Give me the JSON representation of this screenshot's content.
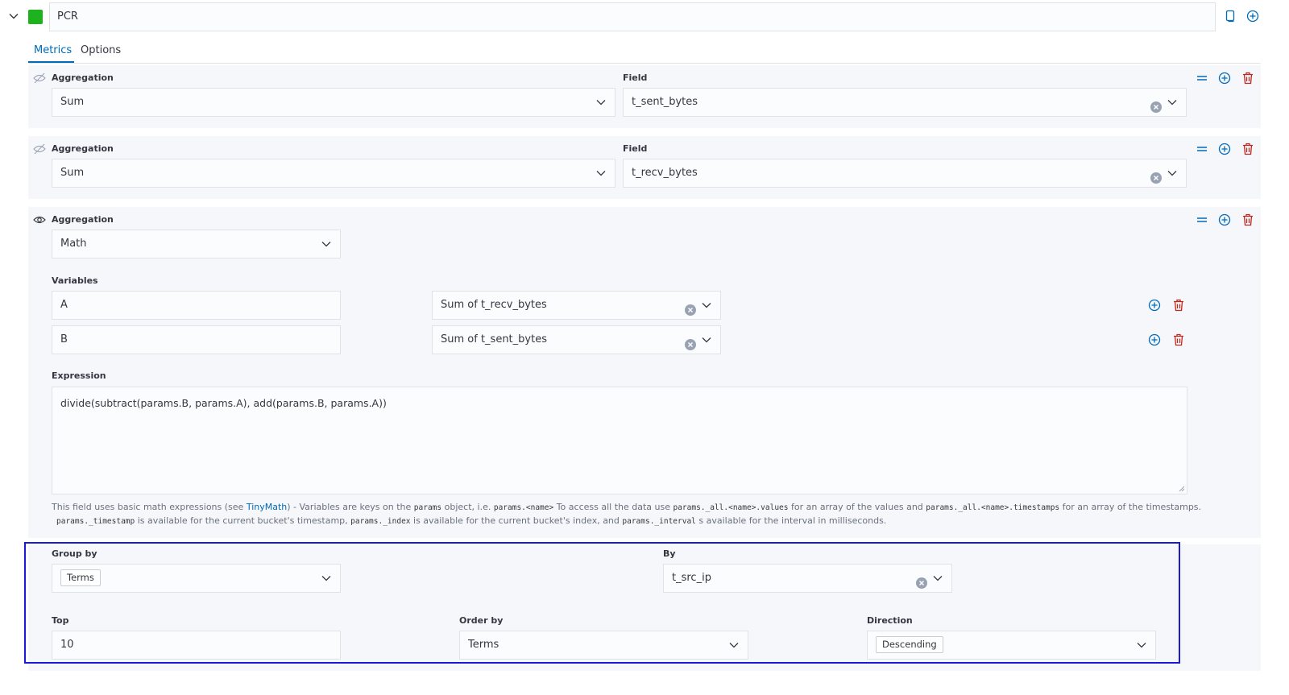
{
  "header": {
    "series_name": "PCR",
    "color": "#1fb21f"
  },
  "tabs": [
    {
      "label": "Metrics",
      "active": true
    },
    {
      "label": "Options",
      "active": false
    }
  ],
  "metrics": [
    {
      "agg_label": "Aggregation",
      "agg_value": "Sum",
      "field_label": "Field",
      "field_value": "t_sent_bytes",
      "visible_icon": "eye-closed-icon"
    },
    {
      "agg_label": "Aggregation",
      "agg_value": "Sum",
      "field_label": "Field",
      "field_value": "t_recv_bytes",
      "visible_icon": "eye-closed-icon"
    }
  ],
  "math": {
    "agg_label": "Aggregation",
    "agg_value": "Math",
    "variables_label": "Variables",
    "variables": [
      {
        "name": "A",
        "metric": "Sum of t_recv_bytes"
      },
      {
        "name": "B",
        "metric": "Sum of t_sent_bytes"
      }
    ],
    "expression_label": "Expression",
    "expression": "divide(subtract(params.B, params.A), add(params.B, params.A))",
    "help": {
      "p1": "This field uses basic math expressions (see ",
      "link": "TinyMath",
      "p2": ") - Variables are keys on the ",
      "c1": "params",
      "p3": " object, i.e. ",
      "c2": "params.<name>",
      "p4": " To access all the data use ",
      "c3": "params._all.<name>.values",
      "p5": " for an array of the values and ",
      "c4": "params._all.<name>.timestamps",
      "p6": " for an array of the timestamps.",
      "c5": "params._timestamp",
      "p7": " is available for the current bucket's timestamp, ",
      "c6": "params._index",
      "p8": " is available for the current bucket's index, and ",
      "c7": "params._interval",
      "p9": " s available for the interval in milliseconds."
    }
  },
  "group": {
    "group_by_label": "Group by",
    "group_by_value": "Terms",
    "by_label": "By",
    "by_value": "t_src_ip",
    "top_label": "Top",
    "top_value": "10",
    "order_by_label": "Order by",
    "order_by_value": "Terms",
    "direction_label": "Direction",
    "direction_value": "Descending"
  },
  "colors": {
    "accent": "#006bb8",
    "danger": "#bd271e",
    "highlight": "#1a1ad6"
  }
}
